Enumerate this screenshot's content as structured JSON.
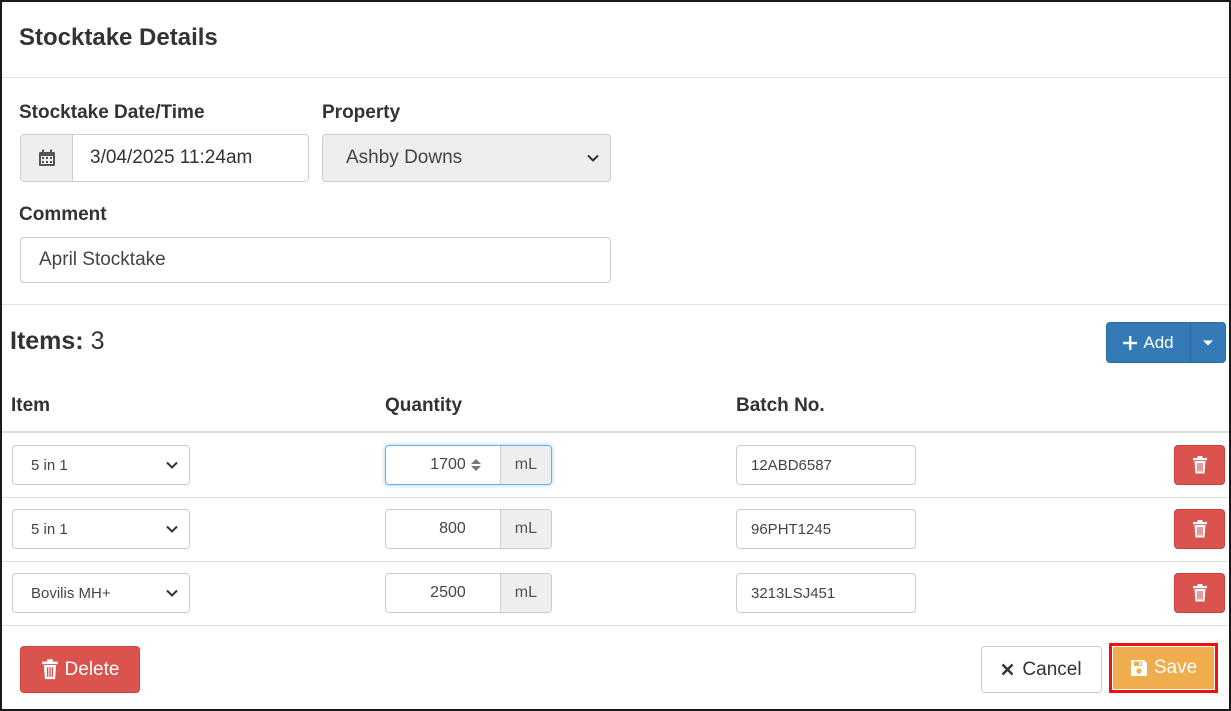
{
  "header": {
    "title": "Stocktake Details"
  },
  "form": {
    "date_label": "Stocktake Date/Time",
    "date_value": "3/04/2025 11:24am",
    "property_label": "Property",
    "property_value": "Ashby Downs",
    "comment_label": "Comment",
    "comment_value": "April Stocktake"
  },
  "items_section": {
    "title": "Items:",
    "count": "3",
    "add_label": "Add",
    "columns": {
      "item": "Item",
      "quantity": "Quantity",
      "batch": "Batch No."
    }
  },
  "rows": [
    {
      "item": "5 in 1",
      "quantity": "1700",
      "unit": "mL",
      "batch": "12ABD6587"
    },
    {
      "item": "5 in 1",
      "quantity": "800",
      "unit": "mL",
      "batch": "96PHT1245"
    },
    {
      "item": "Bovilis MH+",
      "quantity": "2500",
      "unit": "mL",
      "batch": "3213LSJ451"
    }
  ],
  "footer": {
    "delete_label": "Delete",
    "cancel_label": "Cancel",
    "save_label": "Save"
  },
  "colors": {
    "primary": "#337ab7",
    "danger": "#d9534f",
    "warning": "#f0ad4e",
    "highlight": "#ee1111"
  },
  "icons": {
    "date_addon": "calendar-icon",
    "property_select": "chevron-down-icon",
    "add_button": "plus-icon",
    "add_dropdown": "caret-down-icon",
    "quantity_spinner": "spinner-arrows-icon",
    "row_delete": "trash-icon",
    "delete_button": "trash-icon",
    "cancel_button": "close-icon",
    "save_button": "floppy-disk-icon"
  }
}
